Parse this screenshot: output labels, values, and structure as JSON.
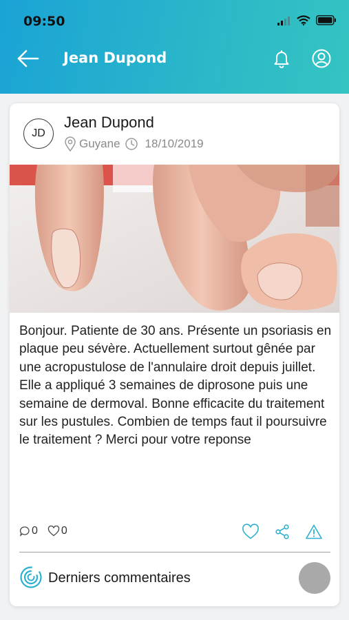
{
  "status_bar": {
    "time": "09:50"
  },
  "app_bar": {
    "title": "Jean Dupond"
  },
  "post": {
    "avatar_initials": "JD",
    "author": "Jean Dupond",
    "location": "Guyane",
    "date": "18/10/2019",
    "body": "Bonjour.  Patiente de 30 ans. Présente un psoriasis en plaque peu sévère. Actuellement surtout gênée par une acropustulose de l'annulaire droit depuis juillet.  Elle a appliqué 3 semaines de diprosone puis une semaine de dermoval. Bonne efficacite du traitement sur les pustules. Combien de temps faut il poursuivre le traitement ? Merci pour votre reponse",
    "comment_count": "0",
    "like_count": "0"
  },
  "comments": {
    "label": "Derniers commentaires"
  },
  "colors": {
    "accent": "#2bb0d0",
    "header_start": "#1aa3d6",
    "header_end": "#34c4c2"
  }
}
